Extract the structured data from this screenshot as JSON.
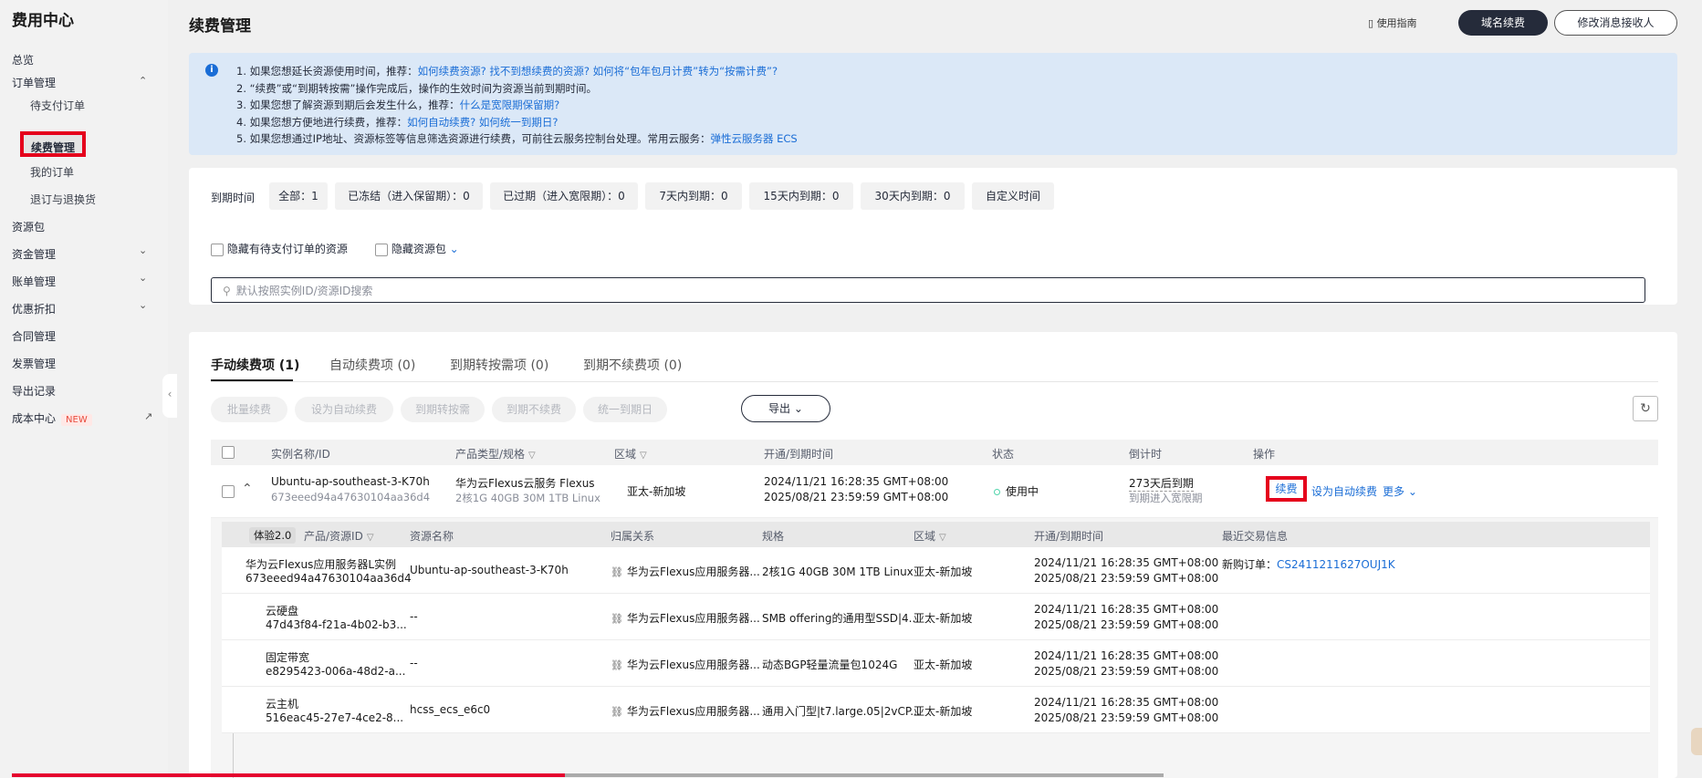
{
  "sidebar": {
    "title": "费用中心",
    "items": [
      {
        "label": "总览"
      },
      {
        "label": "订单管理"
      },
      {
        "label": "待支付订单"
      },
      {
        "label": "续费管理"
      },
      {
        "label": "我的订单"
      },
      {
        "label": "退订与退换货"
      },
      {
        "label": "资源包"
      },
      {
        "label": "资金管理"
      },
      {
        "label": "账单管理"
      },
      {
        "label": "优惠折扣"
      },
      {
        "label": "合同管理"
      },
      {
        "label": "发票管理"
      },
      {
        "label": "导出记录"
      },
      {
        "label": "成本中心",
        "badge": "NEW"
      }
    ]
  },
  "header": {
    "title": "续费管理",
    "guide_label": "使用指南",
    "domain_renew_label": "域名续费",
    "modify_receiver_label": "修改消息接收人"
  },
  "notice": {
    "l1_text": "1. 如果您想延长资源使用时间，推荐：",
    "l1_link1": "如何续费资源?",
    "l1_link2": "找不到想续费的资源?",
    "l1_link3": "如何将“包年包月计费”转为“按需计费”?",
    "l2_text": "2. “续费”或“到期转按需”操作完成后，操作的生效时间为资源当前到期时间。",
    "l3_text": "3. 如果您想了解资源到期后会发生什么，推荐：",
    "l3_link": "什么是宽限期保留期?",
    "l4_text": "4. 如果您想方便地进行续费，推荐：",
    "l4_link1": "如何自动续费?",
    "l4_link2": "如何统一到期日?",
    "l5_text": "5. 如果您想通过IP地址、资源标签等信息筛选资源进行续费，可前往云服务控制台处理。常用云服务：",
    "l5_link": "弹性云服务器 ECS"
  },
  "filter": {
    "label": "到期时间",
    "chips": [
      "全部：1",
      "已冻结（进入保留期）：0",
      "已过期（进入宽限期）：0",
      "7天内到期：0",
      "15天内到期：0",
      "30天内到期：0",
      "自定义时间"
    ],
    "hide_pending_label": "隐藏有待支付订单的资源",
    "hide_package_label": "隐藏资源包",
    "search_placeholder": "默认按照实例ID/资源ID搜索"
  },
  "tabs": [
    {
      "label": "手动续费项 (1)"
    },
    {
      "label": "自动续费项 (0)"
    },
    {
      "label": "到期转按需项 (0)"
    },
    {
      "label": "到期不续费项 (0)"
    }
  ],
  "actions": {
    "batch_renew": "批量续费",
    "set_auto": "设为自动续费",
    "to_ondemand": "到期转按需",
    "no_renew": "到期不续费",
    "unify": "统一到期日",
    "export": "导出"
  },
  "table": {
    "headers": [
      "实例名称/ID",
      "产品类型/规格",
      "区域",
      "开通/到期时间",
      "状态",
      "倒计时",
      "操作"
    ],
    "row": {
      "name": "Ubuntu-ap-southeast-3-K70h",
      "id": "673eeed94a47630104aa36d4",
      "product": "华为云Flexus云服务 Flexus",
      "spec": "2核1G 40GB 30M 1TB Linux",
      "region": "亚太-新加坡",
      "start": "2024/11/21 16:28:35 GMT+08:00",
      "end": "2025/08/21 23:59:59 GMT+08:00",
      "status": "使用中",
      "countdown": "273天后到期",
      "countdown_sub": "到期进入宽限期",
      "op_renew": "续费",
      "op_auto": "设为自动续费",
      "op_more": "更多"
    }
  },
  "subtable": {
    "badge": "体验2.0",
    "headers": [
      "产品/资源ID",
      "资源名称",
      "归属关系",
      "规格",
      "区域",
      "开通/到期时间",
      "最近交易信息"
    ],
    "rows": [
      {
        "product": "华为云Flexus应用服务器L实例",
        "rid": "673eeed94a47630104aa36d4",
        "name": "Ubuntu-ap-southeast-3-K70h",
        "belong": "华为云Flexus应用服务器...",
        "spec": "2核1G 40GB 30M 1TB Linux",
        "region": "亚太-新加坡",
        "start": "2024/11/21 16:28:35 GMT+08:00",
        "end": "2025/08/21 23:59:59 GMT+08:00",
        "trade_label": "新购订单：",
        "trade_id": "CS2411211627OUJ1K"
      },
      {
        "product": "云硬盘",
        "rid": "47d43f84-f21a-4b02-b3...",
        "name": "--",
        "belong": "华为云Flexus应用服务器...",
        "spec": "SMB offering的通用型SSD|4...",
        "region": "亚太-新加坡",
        "start": "2024/11/21 16:28:35 GMT+08:00",
        "end": "2025/08/21 23:59:59 GMT+08:00"
      },
      {
        "product": "固定带宽",
        "rid": "e8295423-006a-48d2-a...",
        "name": "--",
        "belong": "华为云Flexus应用服务器...",
        "spec": "动态BGP轻量流量包1024G",
        "region": "亚太-新加坡",
        "start": "2024/11/21 16:28:35 GMT+08:00",
        "end": "2025/08/21 23:59:59 GMT+08:00"
      },
      {
        "product": "云主机",
        "rid": "516eac45-27e7-4ce2-8...",
        "name": "hcss_ecs_e6c0",
        "belong": "华为云Flexus应用服务器...",
        "spec": "通用入门型|t7.large.05|2vCP...",
        "region": "亚太-新加坡",
        "start": "2024/11/21 16:28:35 GMT+08:00",
        "end": "2025/08/21 23:59:59 GMT+08:00"
      }
    ]
  },
  "video_progress": 0.48,
  "colors": {
    "accent": "#1a6dd6",
    "highlight": "#e5001c",
    "dark": "#252b3a",
    "status": "#50d4ab"
  }
}
